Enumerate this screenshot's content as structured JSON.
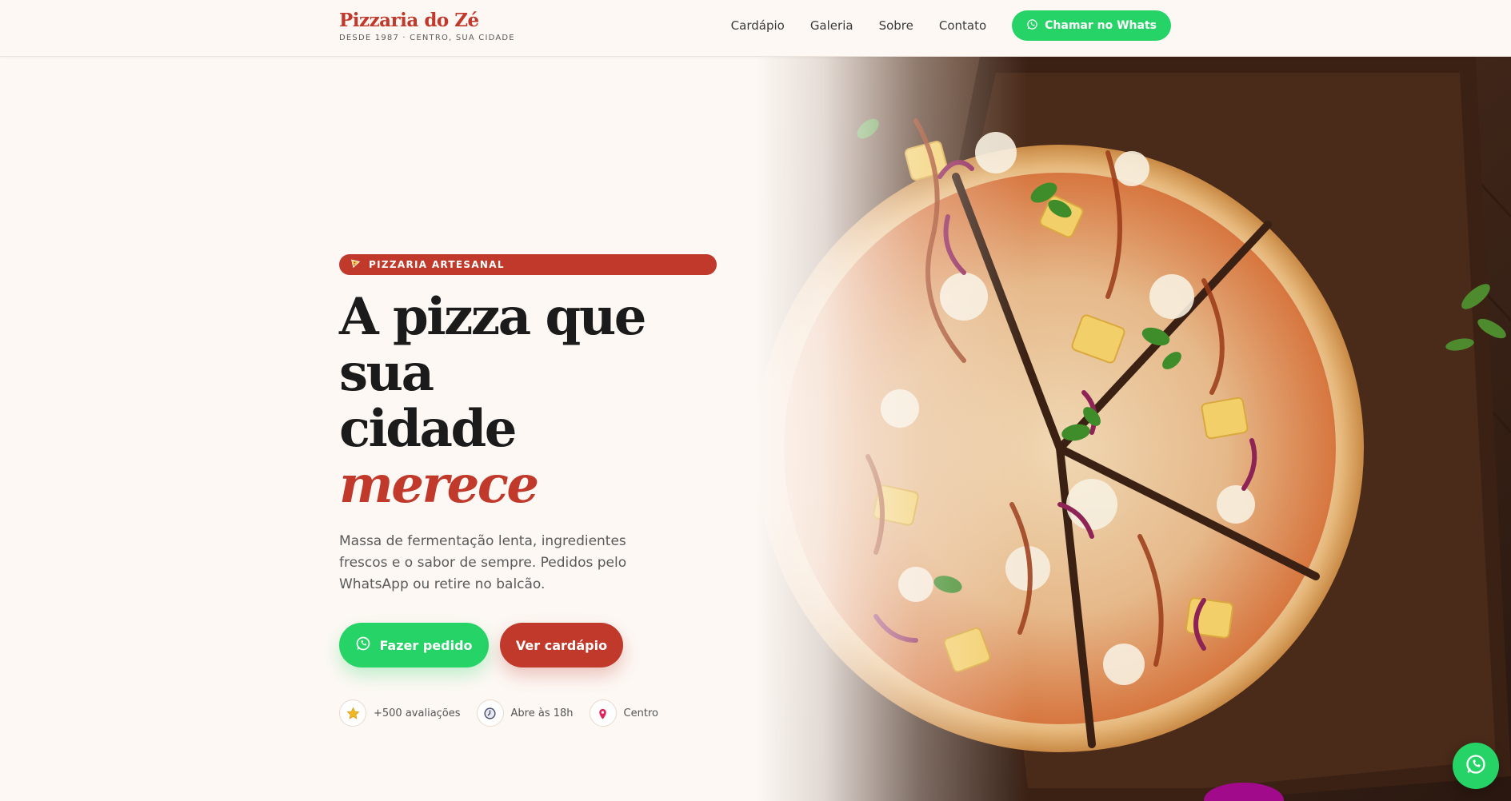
{
  "header": {
    "brand_name": "Pizzaria do Zé",
    "brand_tagline": "DESDE 1987 · CENTRO, SUA CIDADE",
    "nav": [
      {
        "label": "Cardápio"
      },
      {
        "label": "Galeria"
      },
      {
        "label": "Sobre"
      },
      {
        "label": "Contato"
      }
    ],
    "cta_label": "Chamar no Whats"
  },
  "hero": {
    "badge_label": "PIZZARIA ARTESANAL",
    "badge_icon": "pizza-slice-icon",
    "headline_line1": "A pizza que sua",
    "headline_line2_plain": "cidade ",
    "headline_line2_accent": "merece",
    "lead": "Massa de fermentação lenta, ingredientes frescos e o sabor de sempre. Pedidos pelo WhatsApp ou retire no balcão.",
    "primary_cta": "Fazer pedido",
    "secondary_cta": "Ver cardápio",
    "stats": [
      {
        "icon": "star-icon",
        "label": "+500 avaliações"
      },
      {
        "icon": "clock-icon",
        "label": "Abre às 18h"
      },
      {
        "icon": "location-pin-icon",
        "label": "Centro"
      }
    ]
  },
  "colors": {
    "brand_red": "#c0392b",
    "whatsapp_green": "#25d366",
    "background": "#fdf8f4",
    "text_dark": "#1b1b1b"
  }
}
